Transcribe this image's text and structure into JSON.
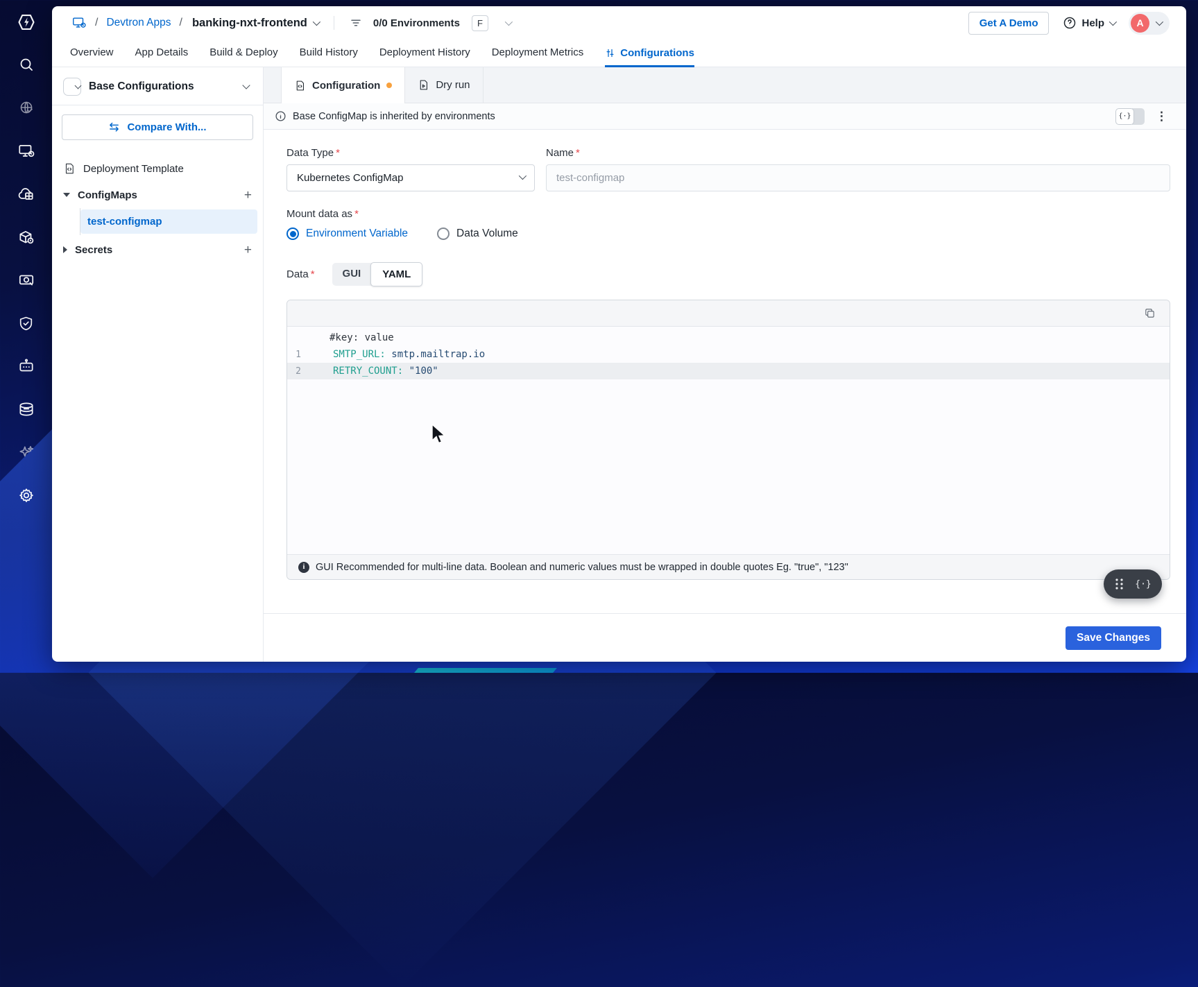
{
  "colors": {
    "accent": "#0066cc",
    "save_button": "#2a62dd",
    "avatar_bg": "#f2696b",
    "unsaved_dot": "#f8a13e",
    "code_key": "#1e9e8e",
    "code_value": "#264b72"
  },
  "rail_icons": [
    "devtron-logo",
    "search",
    "global-config",
    "applications",
    "app-groups",
    "chart-store",
    "resource-browser",
    "security",
    "jobs",
    "clusters",
    "ai-assistant",
    "settings"
  ],
  "header": {
    "crumb_sep": "/",
    "apps_link": "Devtron Apps",
    "app_name": "banking-nxt-frontend",
    "environments_label": "0/0 Environments",
    "environments_badge": "F",
    "get_demo": "Get A Demo",
    "help": "Help",
    "avatar_initial": "A"
  },
  "nav_tabs": {
    "items": [
      "Overview",
      "App Details",
      "Build & Deploy",
      "Build History",
      "Deployment History",
      "Deployment Metrics",
      "Configurations"
    ],
    "active": "Configurations"
  },
  "sidebar": {
    "title": "Base Configurations",
    "compare_button": "Compare With...",
    "deployment_template": "Deployment Template",
    "configmaps_label": "ConfigMaps",
    "selected_configmap": "test-configmap",
    "secrets_label": "Secrets"
  },
  "main": {
    "tab_configuration": "Configuration",
    "tab_dry_run": "Dry run",
    "banner": "Base ConfigMap is inherited by environments",
    "form": {
      "required": "*",
      "data_type_label": "Data Type",
      "data_type_value": "Kubernetes ConfigMap",
      "name_label": "Name",
      "name_value": "test-configmap",
      "mount_label": "Mount data as",
      "mount_option_env": "Environment Variable",
      "mount_option_volume": "Data Volume",
      "mount_selected": "Environment Variable",
      "data_label": "Data",
      "mode_gui": "GUI",
      "mode_yaml": "YAML",
      "mode_selected": "YAML"
    },
    "editor": {
      "hint": "#key: value",
      "lines": [
        {
          "num": "1",
          "key": "SMTP_URL:",
          "value": " smtp.mailtrap.io"
        },
        {
          "num": "2",
          "key": "RETRY_COUNT:",
          "value": " \"100\""
        }
      ],
      "footer_note": "GUI Recommended for multi-line data. Boolean and numeric values must be wrapped in double quotes Eg. \"true\", \"123\""
    },
    "save_button": "Save Changes"
  }
}
